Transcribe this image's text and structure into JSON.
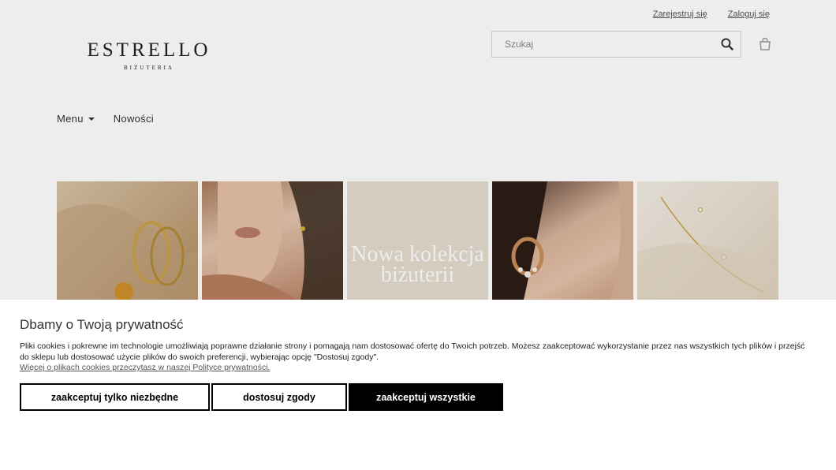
{
  "header": {
    "top_links": {
      "register": "Zarejestruj się",
      "login": "Zaloguj się"
    },
    "logo": {
      "main": "ESTRELLO",
      "sub": "BIŻUTERIA"
    },
    "search": {
      "placeholder": "Szukaj",
      "icon": "search-icon"
    },
    "cart": {
      "icon": "cart-icon"
    }
  },
  "nav": {
    "menu_label": "Menu",
    "new_label": "Nowości"
  },
  "gallery": {
    "tiles": [
      {
        "alt": ""
      },
      {
        "alt": ""
      },
      {
        "text": "Nowa kolekcja biżuterii"
      },
      {
        "alt": ""
      },
      {
        "alt": ""
      }
    ]
  },
  "cookie_banner": {
    "title": "Dbamy o Twoją prywatność",
    "text": "Pliki cookies i pokrewne im technologie umożliwiają poprawne działanie strony i pomagają nam dostosować ofertę do Twoich potrzeb. Możesz zaakceptować wykorzystanie przez nas wszystkich tych plików i przejść do sklepu lub dostosować użycie plików do swoich preferencji, wybierając opcję \"Dostosuj zgody\".",
    "link": "Więcej o plikach cookies przeczytasz w naszej Polityce prywatności.",
    "buttons": {
      "necessary": "zaakceptuj tylko niezbędne",
      "customize": "dostosuj zgody",
      "accept_all": "zaakceptuj wszystkie"
    }
  },
  "colors": {
    "accent": "#000000",
    "banner_bg": "#ffffff"
  }
}
